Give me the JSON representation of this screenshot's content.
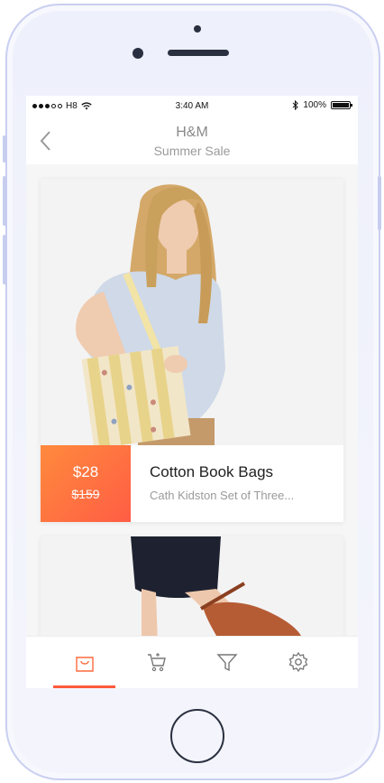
{
  "status_bar": {
    "carrier": "H8",
    "time": "3:40 AM",
    "battery": "100%"
  },
  "nav": {
    "title": "H&M",
    "subtitle": "Summer Sale",
    "back_icon": "chevron-left-icon"
  },
  "products": [
    {
      "price": "$28",
      "old_price": "$159",
      "title": "Cotton Book Bags",
      "subtitle": "Cath Kidston Set of Three..."
    }
  ],
  "tab_bar": {
    "tabs": [
      "shopping-bag-icon",
      "cart-icon",
      "filter-icon",
      "settings-icon"
    ],
    "active_index": 0
  },
  "colors": {
    "accent": "#ff5a3c",
    "price_gradient_start": "#ff8a3d",
    "price_gradient_end": "#ff5d44"
  }
}
